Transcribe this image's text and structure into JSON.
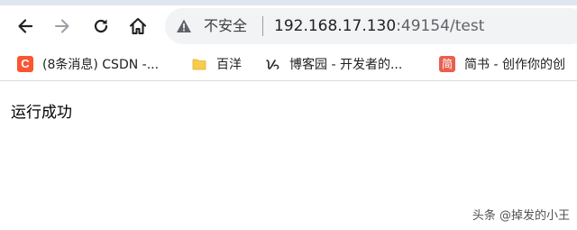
{
  "omnibox": {
    "security_label": "不安全",
    "url_host": "192.168.17.130",
    "url_rest": ":49154/test"
  },
  "bookmarks": [
    {
      "label": "(8条消息) CSDN -...",
      "icon": "csdn-icon",
      "icon_text": "C",
      "color": "#fc5531"
    },
    {
      "label": "百洋",
      "icon": "folder-icon",
      "color": "#f6cc4b"
    },
    {
      "label": "博客园 - 开发者的...",
      "icon": "cnblogs-icon"
    },
    {
      "label": "简书 - 创作你的创",
      "icon": "jianshu-icon",
      "icon_text": "简",
      "color": "#e9604f"
    }
  ],
  "page": {
    "body_text": "运行成功"
  },
  "watermark": {
    "text": "头条 @掉发的小王"
  }
}
